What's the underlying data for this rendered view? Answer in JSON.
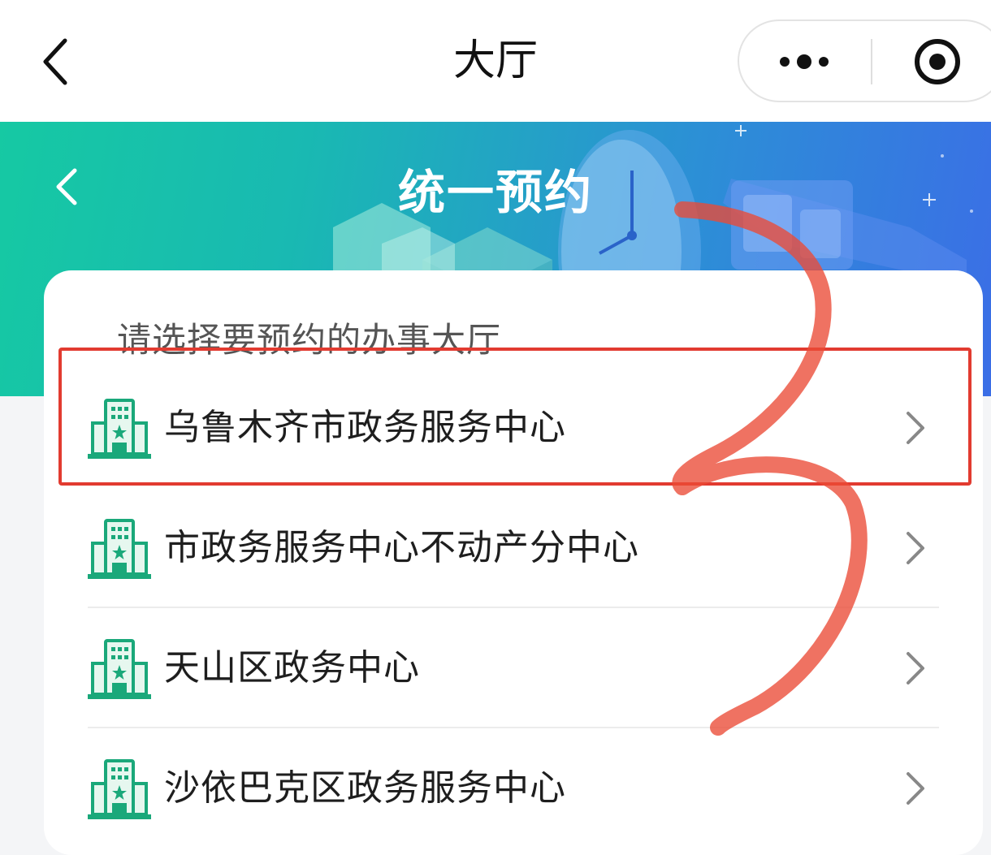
{
  "navbar": {
    "title": "大厅"
  },
  "banner": {
    "title": "统一预约"
  },
  "card": {
    "prompt": "请选择要预约的办事大厅",
    "halls": [
      {
        "label": "乌鲁木齐市政务服务中心"
      },
      {
        "label": "市政务服务中心不动产分中心"
      },
      {
        "label": "天山区政务中心"
      },
      {
        "label": "沙依巴克区政务服务中心"
      }
    ]
  },
  "icons": {
    "nav_back": "chevron-left-icon",
    "more": "more-dots-icon",
    "close": "target-circle-icon",
    "banner_back": "chevron-left-icon",
    "hall": "building-icon",
    "row_arrow": "chevron-right-icon"
  },
  "colors": {
    "banner_start": "#16c9a3",
    "banner_end": "#3b6ee6",
    "hall_icon": "#1aa87a",
    "annotation": "#e23b30"
  }
}
